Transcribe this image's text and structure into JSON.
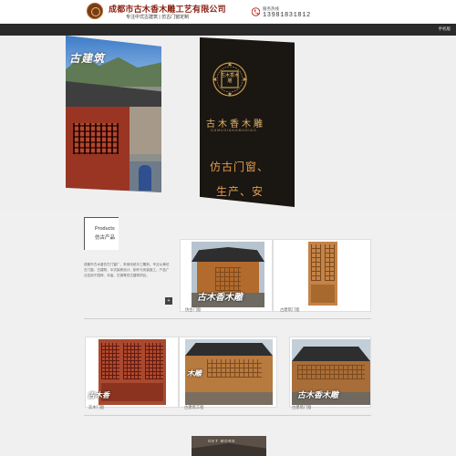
{
  "header": {
    "company_name": "成都市古木香木雕工艺有限公司",
    "tagline": "专注中式古建筑 | 仿古门窗定制",
    "phone_label": "服务热线",
    "phone_number": "13981831812"
  },
  "nav": {
    "mobile_label": "手机版"
  },
  "hero": {
    "left_brush_text": "古建筑",
    "seal_text": "古木香木雕",
    "brand_cn": "古木香木雕",
    "brand_en": "GUMUXIANGMUDIAO",
    "slogan_line1": "仿古门窗、",
    "slogan_line2": "生产、安"
  },
  "products": {
    "title_en": "Products",
    "title_cn": "仿古产品",
    "description": "成都市古木香仿古门窗厂，采用传统手工雕刻，专业从事仿古门窗、古建筑、中式装修设计、制作与安装施工，产品广泛应用于园林、寺庙、古镇等仿古建筑项目。",
    "more_label": "+",
    "items": [
      {
        "caption": "仿古门窗",
        "watermark": "古木香木雕"
      },
      {
        "caption": "古建筑门窗",
        "watermark": ""
      },
      {
        "caption": "实木门窗",
        "watermark": "古木香"
      },
      {
        "caption": "古建筑工程",
        "watermark": "木雕"
      },
      {
        "caption": "古建筑门窗",
        "watermark": "古木香木雕"
      }
    ]
  },
  "get_more": {
    "label": "GET MORE"
  },
  "colors": {
    "brand_red": "#8a2415",
    "gold": "#e3b56a",
    "nav_dark": "#2a2a2a",
    "side_tab_green": "#7ec84b"
  },
  "icons": {
    "logo": "seal-logo-icon",
    "phone": "phone-icon",
    "side": "chat-icon"
  }
}
